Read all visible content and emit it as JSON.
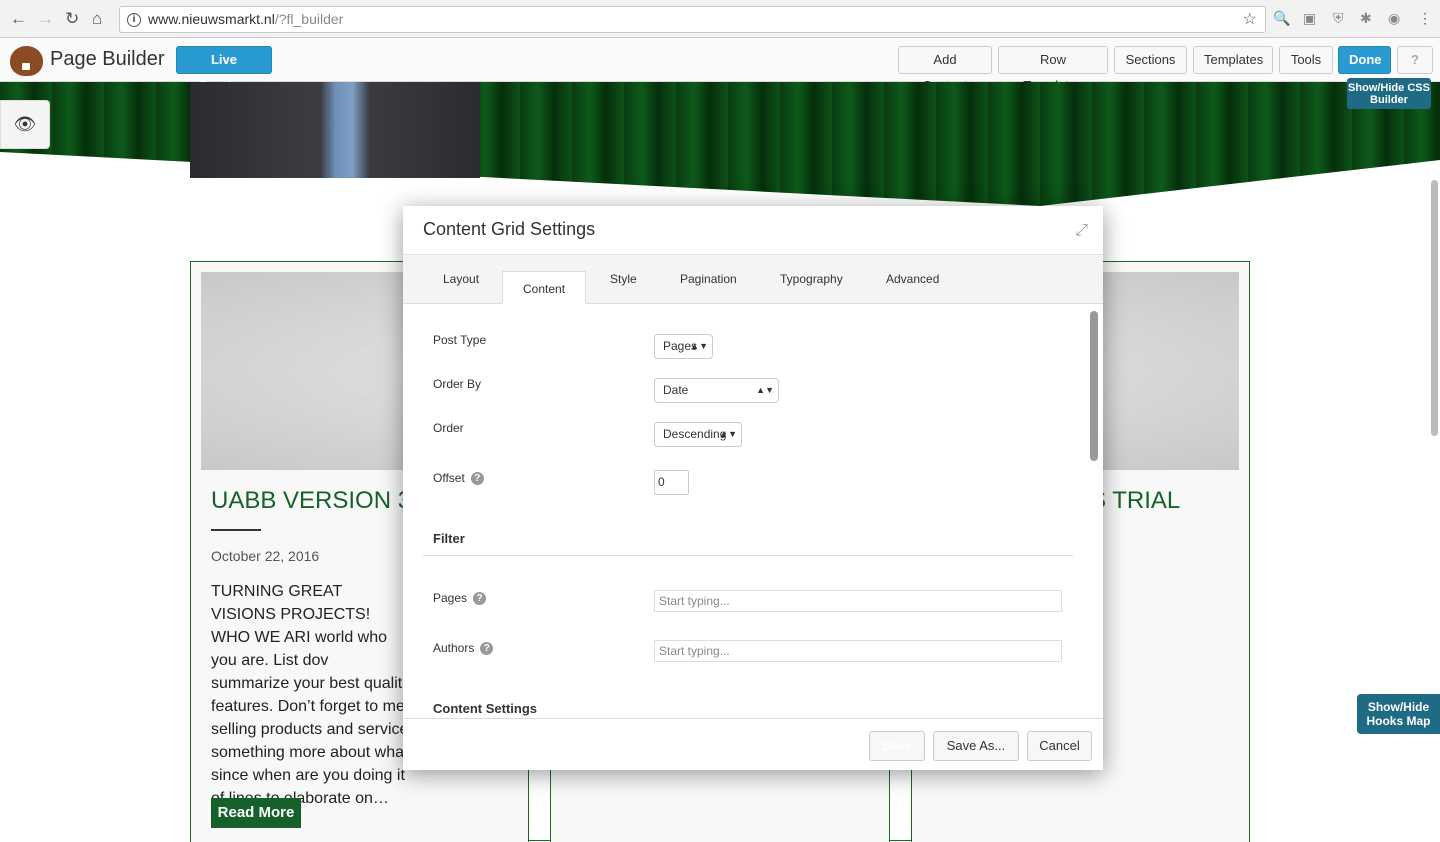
{
  "browser": {
    "url_host": "www.nieuwsmarkt.nl",
    "url_path": "/?fl_builder"
  },
  "builder": {
    "title": "Page Builder",
    "live_preview": "Live Preview",
    "buttons": [
      "Add Content",
      "Row Templates",
      "Sections",
      "Templates",
      "Tools"
    ],
    "done": "Done",
    "help": "?"
  },
  "overlays": {
    "css_builder": "Show/Hide CSS Builder",
    "hooks_map": "Show/Hide Hooks Map"
  },
  "cards": [
    {
      "title": "UABB VERSION 3",
      "date": "October 22, 2016",
      "excerpt": "TURNING GREAT VISIONS PROJECTS! WHO WE ARI world who you are. List dov summarize your best qualit features. Don’t forget to me selling products and service something more about wha since when are you doing it of lines to elaborate on…",
      "button": "Read More"
    },
    {
      "title": "S TRIAL"
    }
  ],
  "modal": {
    "title": "Content Grid Settings",
    "tabs": [
      "Layout",
      "Content",
      "Style",
      "Pagination",
      "Typography",
      "Advanced"
    ],
    "active_tab": "Content",
    "fields": {
      "post_type": {
        "label": "Post Type",
        "value": "Pages"
      },
      "order_by": {
        "label": "Order By",
        "value": "Date"
      },
      "order": {
        "label": "Order",
        "value": "Descending"
      },
      "offset": {
        "label": "Offset",
        "value": "0"
      }
    },
    "filter": {
      "heading": "Filter",
      "pages": {
        "label": "Pages",
        "placeholder": "Start typing..."
      },
      "authors": {
        "label": "Authors",
        "placeholder": "Start typing..."
      }
    },
    "content_settings": "Content Settings",
    "footer": {
      "save": "Save",
      "save_as": "Save As...",
      "cancel": "Cancel"
    }
  },
  "colors": {
    "accent": "#2a9bd0",
    "brand_green": "#16612a",
    "overlay_teal": "#1f6a85"
  }
}
